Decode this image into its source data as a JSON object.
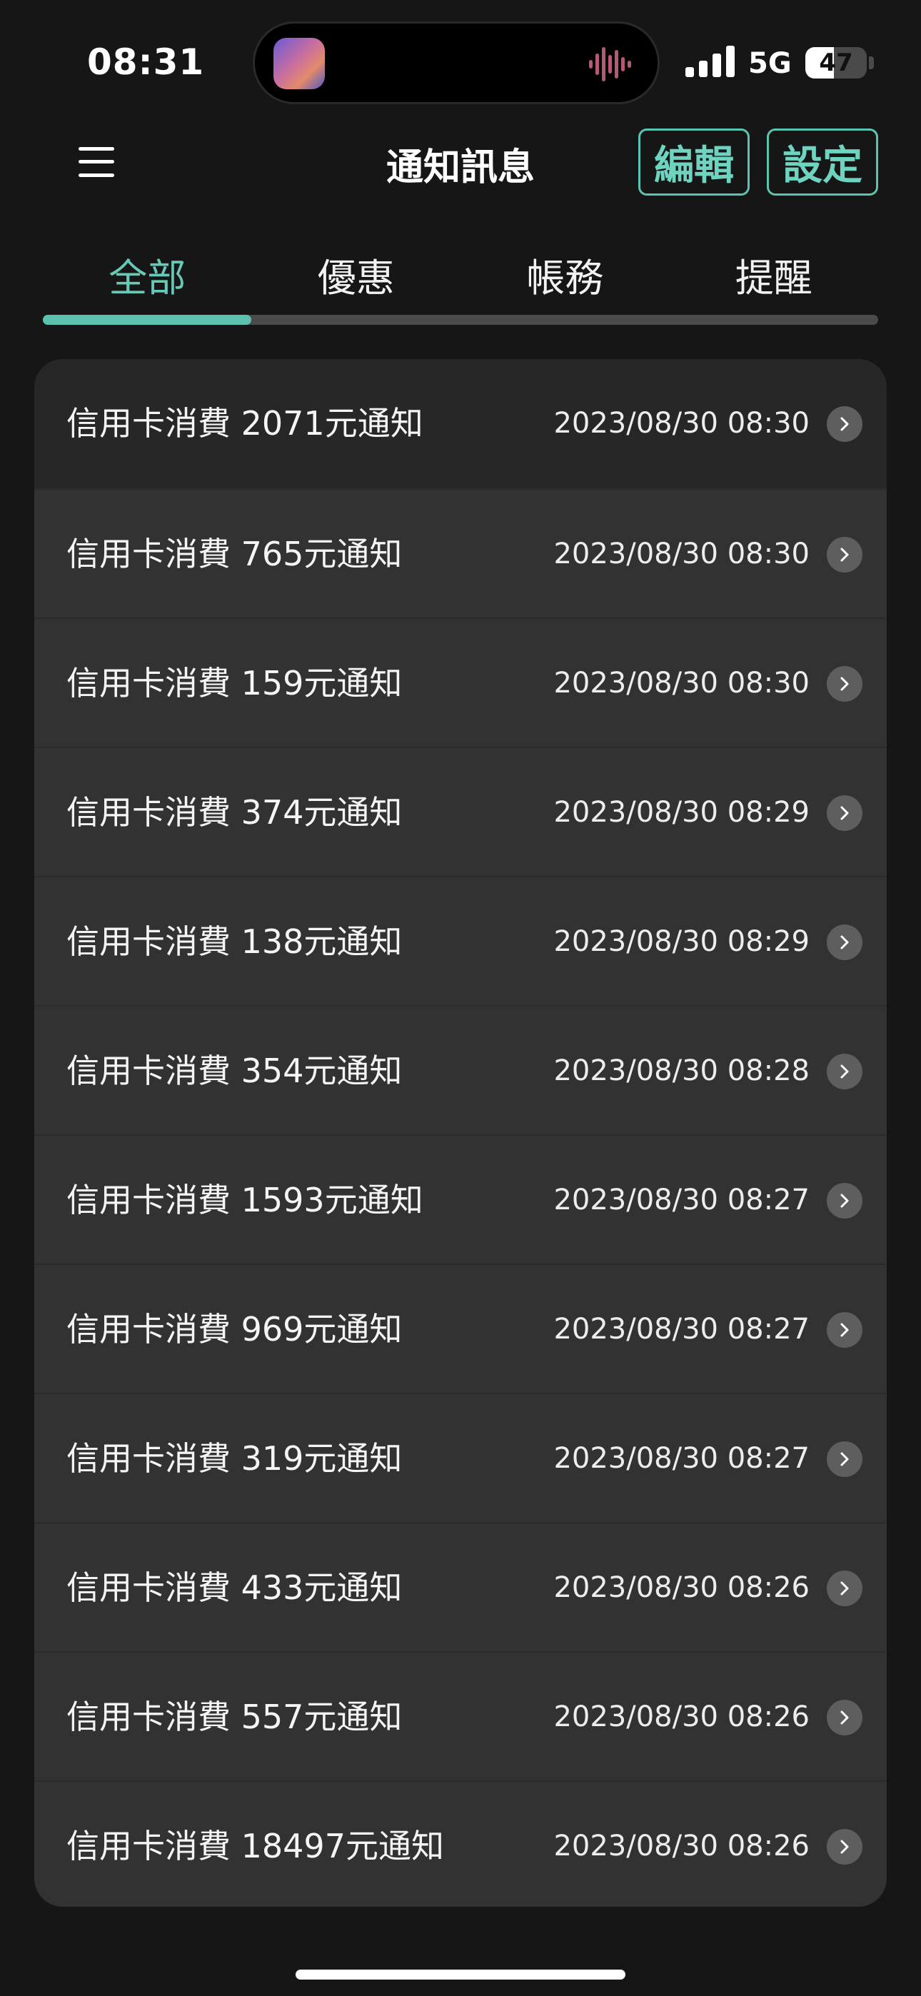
{
  "status_bar": {
    "time": "08:31",
    "network": "5G",
    "battery_level": "47",
    "battery_fraction": 0.47,
    "icons": [
      "album-art-icon",
      "waveform-icon",
      "signal-icon",
      "battery-icon"
    ]
  },
  "header": {
    "title": "通知訊息",
    "edit_label": "編輯",
    "settings_label": "設定",
    "menu_icon": "hamburger-menu-icon"
  },
  "tabs": [
    {
      "label": "全部",
      "active": true
    },
    {
      "label": "優惠",
      "active": false
    },
    {
      "label": "帳務",
      "active": false
    },
    {
      "label": "提醒",
      "active": false
    }
  ],
  "notifications": [
    {
      "title": "信用卡消費 2071元通知",
      "time": "2023/08/30 08:30"
    },
    {
      "title": "信用卡消費 765元通知",
      "time": "2023/08/30 08:30"
    },
    {
      "title": "信用卡消費 159元通知",
      "time": "2023/08/30 08:30"
    },
    {
      "title": "信用卡消費 374元通知",
      "time": "2023/08/30 08:29"
    },
    {
      "title": "信用卡消費 138元通知",
      "time": "2023/08/30 08:29"
    },
    {
      "title": "信用卡消費 354元通知",
      "time": "2023/08/30 08:28"
    },
    {
      "title": "信用卡消費 1593元通知",
      "time": "2023/08/30 08:27"
    },
    {
      "title": "信用卡消費 969元通知",
      "time": "2023/08/30 08:27"
    },
    {
      "title": "信用卡消費 319元通知",
      "time": "2023/08/30 08:27"
    },
    {
      "title": "信用卡消費 433元通知",
      "time": "2023/08/30 08:26"
    },
    {
      "title": "信用卡消費 557元通知",
      "time": "2023/08/30 08:26"
    },
    {
      "title": "信用卡消費 18497元通知",
      "time": "2023/08/30 08:26"
    }
  ],
  "colors": {
    "background": "#161616",
    "accent": "#5cc5b2",
    "list_bg": "#323232",
    "first_row_bg": "#272727"
  }
}
